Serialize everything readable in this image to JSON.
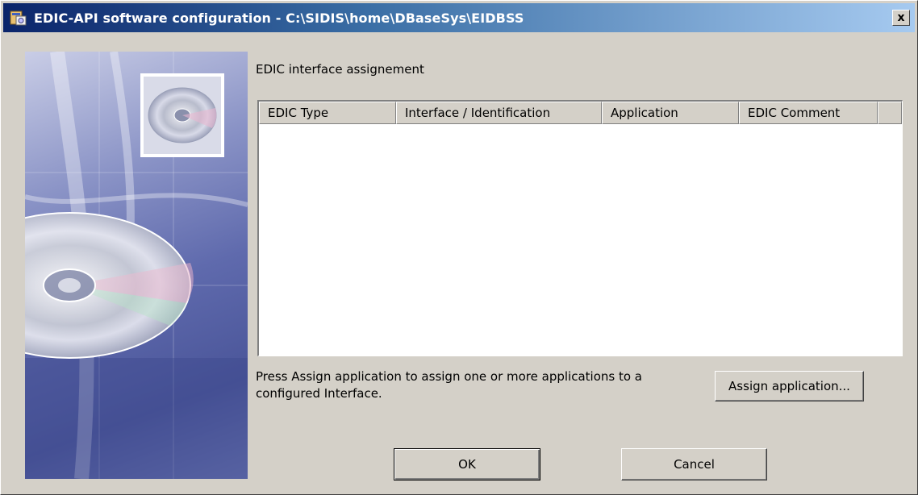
{
  "window": {
    "title": "EDIC-API software configuration - C:\\SIDIS\\home\\DBaseSys\\EIDBSS",
    "close_glyph": "x"
  },
  "main": {
    "section_label": "EDIC interface assignement",
    "table": {
      "columns": [
        "EDIC Type",
        "Interface / Identification",
        "Application",
        "EDIC Comment"
      ],
      "rows": []
    },
    "description": "Press Assign application to assign one or more applications to a configured Interface.",
    "assign_button_label": "Assign application..."
  },
  "footer": {
    "ok_label": "OK",
    "cancel_label": "Cancel"
  },
  "colors": {
    "face": "#d4d0c8",
    "title_start": "#0a246a",
    "title_end": "#a6caf0"
  },
  "icons": [
    "app-icon",
    "close-icon",
    "cd-image"
  ]
}
